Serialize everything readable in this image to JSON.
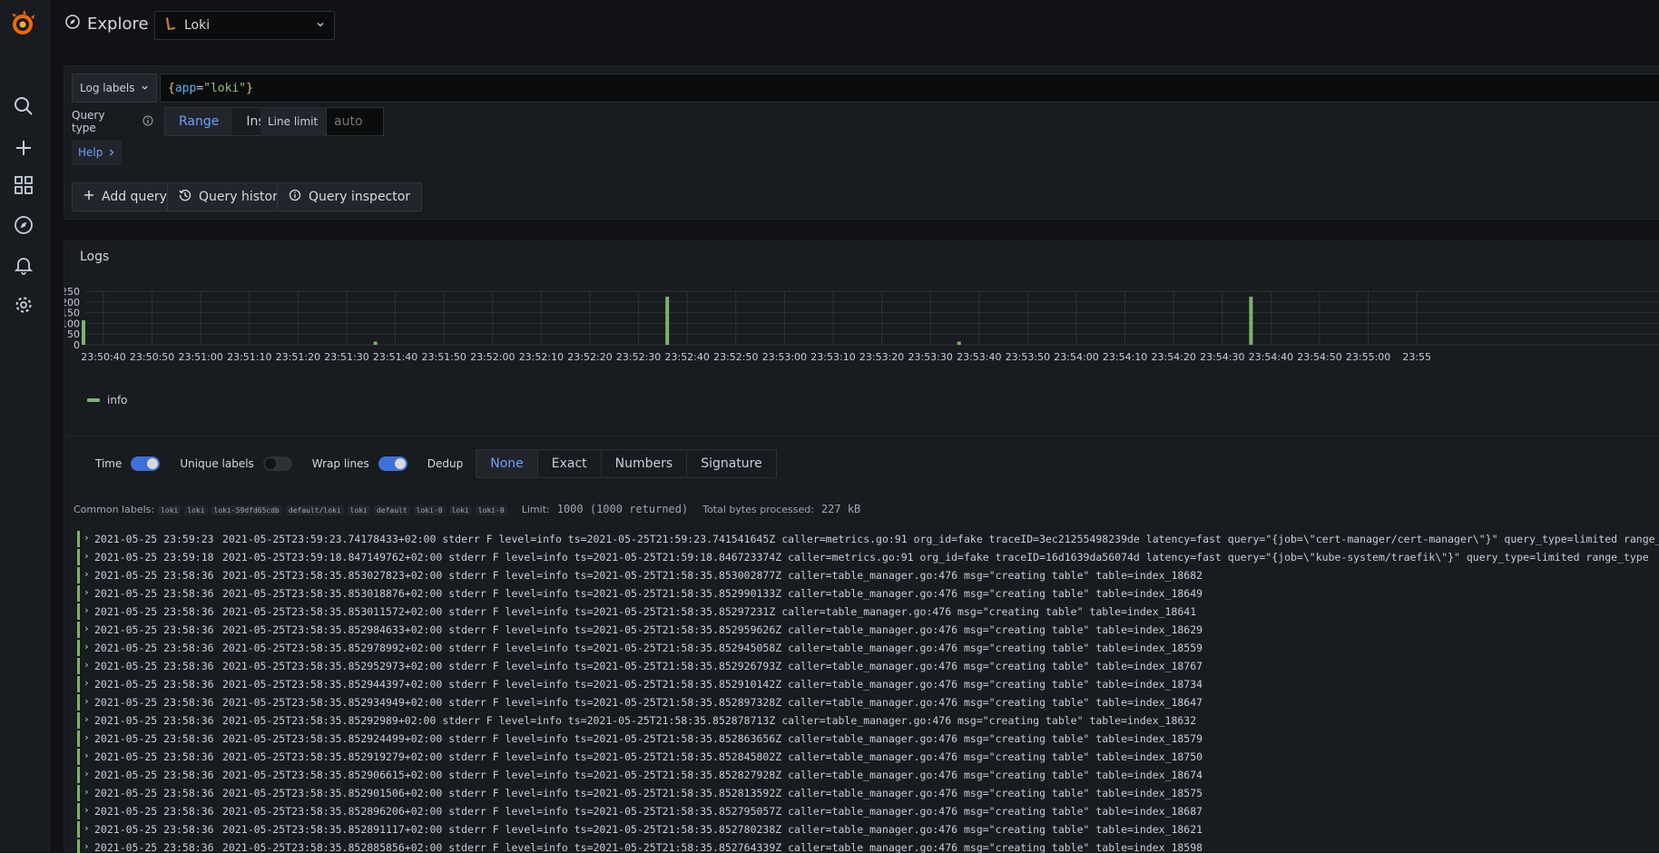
{
  "app": {
    "title": "Explore",
    "datasource": "Loki"
  },
  "sidemenu": {
    "items": [
      "search-icon",
      "plus-icon",
      "dashboards-icon",
      "explore-icon",
      "alert-bell-icon",
      "gear-icon"
    ]
  },
  "query": {
    "log_labels_button": "Log labels",
    "expression": {
      "open": "{",
      "key": "app",
      "eq": "=",
      "value": "\"loki\"",
      "close": "}"
    },
    "query_type_label": "Query type",
    "query_types": [
      "Range",
      "Instant"
    ],
    "active_query_type": "Range",
    "line_limit_label": "Line limit",
    "line_limit_placeholder": "auto",
    "help_label": "Help",
    "actions": {
      "add_query": "Add query",
      "query_history": "Query history",
      "query_inspector": "Query inspector"
    }
  },
  "logs": {
    "title": "Logs",
    "options": {
      "time_label": "Time",
      "time_on": true,
      "unique_labels_label": "Unique labels",
      "unique_labels_on": false,
      "wrap_lines_label": "Wrap lines",
      "wrap_lines_on": true,
      "dedup_label": "Dedup",
      "dedup_options": [
        "None",
        "Exact",
        "Numbers",
        "Signature"
      ],
      "dedup_active": "None"
    },
    "common_labels_label": "Common labels:",
    "common_labels": [
      "loki",
      "loki",
      "loki-59dfd65cdb",
      "default/loki",
      "loki",
      "default",
      "loki-0",
      "loki",
      "loki-0"
    ],
    "limit_label": "Limit:",
    "limit_value": "1000 (1000 returned)",
    "bytes_label": "Total bytes processed:",
    "bytes_value": "227 kB",
    "rows": [
      {
        "ts": "2021-05-25 23:59:23",
        "line": "2021-05-25T23:59:23.74178433+02:00 stderr F level=info ts=2021-05-25T21:59:23.741541645Z caller=metrics.go:91 org_id=fake traceID=3ec21255498239de latency=fast query=\"{job=\\\"cert-manager/cert-manager\\\"}\" query_type=limited range_ty"
      },
      {
        "ts": "2021-05-25 23:59:18",
        "line": "2021-05-25T23:59:18.847149762+02:00 stderr F level=info ts=2021-05-25T21:59:18.846723374Z caller=metrics.go:91 org_id=fake traceID=16d1639da56074d latency=fast query=\"{job=\\\"kube-system/traefik\\\"}\" query_type=limited range_type"
      },
      {
        "ts": "2021-05-25 23:58:36",
        "line": "2021-05-25T23:58:35.853027823+02:00 stderr F level=info ts=2021-05-25T21:58:35.853002877Z caller=table_manager.go:476 msg=\"creating table\" table=index_18682"
      },
      {
        "ts": "2021-05-25 23:58:36",
        "line": "2021-05-25T23:58:35.853018876+02:00 stderr F level=info ts=2021-05-25T21:58:35.852990133Z caller=table_manager.go:476 msg=\"creating table\" table=index_18649"
      },
      {
        "ts": "2021-05-25 23:58:36",
        "line": "2021-05-25T23:58:35.853011572+02:00 stderr F level=info ts=2021-05-25T21:58:35.85297231Z caller=table_manager.go:476 msg=\"creating table\" table=index_18641"
      },
      {
        "ts": "2021-05-25 23:58:36",
        "line": "2021-05-25T23:58:35.852984633+02:00 stderr F level=info ts=2021-05-25T21:58:35.852959626Z caller=table_manager.go:476 msg=\"creating table\" table=index_18629"
      },
      {
        "ts": "2021-05-25 23:58:36",
        "line": "2021-05-25T23:58:35.852978992+02:00 stderr F level=info ts=2021-05-25T21:58:35.852945058Z caller=table_manager.go:476 msg=\"creating table\" table=index_18559"
      },
      {
        "ts": "2021-05-25 23:58:36",
        "line": "2021-05-25T23:58:35.852952973+02:00 stderr F level=info ts=2021-05-25T21:58:35.852926793Z caller=table_manager.go:476 msg=\"creating table\" table=index_18767"
      },
      {
        "ts": "2021-05-25 23:58:36",
        "line": "2021-05-25T23:58:35.852944397+02:00 stderr F level=info ts=2021-05-25T21:58:35.852910142Z caller=table_manager.go:476 msg=\"creating table\" table=index_18734"
      },
      {
        "ts": "2021-05-25 23:58:36",
        "line": "2021-05-25T23:58:35.852934949+02:00 stderr F level=info ts=2021-05-25T21:58:35.852897328Z caller=table_manager.go:476 msg=\"creating table\" table=index_18647"
      },
      {
        "ts": "2021-05-25 23:58:36",
        "line": "2021-05-25T23:58:35.85292989+02:00 stderr F level=info ts=2021-05-25T21:58:35.852878713Z caller=table_manager.go:476 msg=\"creating table\" table=index_18632"
      },
      {
        "ts": "2021-05-25 23:58:36",
        "line": "2021-05-25T23:58:35.852924499+02:00 stderr F level=info ts=2021-05-25T21:58:35.852863656Z caller=table_manager.go:476 msg=\"creating table\" table=index_18579"
      },
      {
        "ts": "2021-05-25 23:58:36",
        "line": "2021-05-25T23:58:35.852919279+02:00 stderr F level=info ts=2021-05-25T21:58:35.852845802Z caller=table_manager.go:476 msg=\"creating table\" table=index_18750"
      },
      {
        "ts": "2021-05-25 23:58:36",
        "line": "2021-05-25T23:58:35.852906615+02:00 stderr F level=info ts=2021-05-25T21:58:35.852827928Z caller=table_manager.go:476 msg=\"creating table\" table=index_18674"
      },
      {
        "ts": "2021-05-25 23:58:36",
        "line": "2021-05-25T23:58:35.852901506+02:00 stderr F level=info ts=2021-05-25T21:58:35.852813592Z caller=table_manager.go:476 msg=\"creating table\" table=index_18575"
      },
      {
        "ts": "2021-05-25 23:58:36",
        "line": "2021-05-25T23:58:35.852896206+02:00 stderr F level=info ts=2021-05-25T21:58:35.852795057Z caller=table_manager.go:476 msg=\"creating table\" table=index_18687"
      },
      {
        "ts": "2021-05-25 23:58:36",
        "line": "2021-05-25T23:58:35.852891117+02:00 stderr F level=info ts=2021-05-25T21:58:35.852780238Z caller=table_manager.go:476 msg=\"creating table\" table=index_18621"
      },
      {
        "ts": "2021-05-25 23:58:36",
        "line": "2021-05-25T23:58:35.852885856+02:00 stderr F level=info ts=2021-05-25T21:58:35.852764339Z caller=table_manager.go:476 msg=\"creating table\" table=index_18598"
      }
    ]
  },
  "chart_data": {
    "type": "bar",
    "title": "",
    "xlabel": "",
    "ylabel": "",
    "ylim": [
      0,
      250
    ],
    "y_ticks": [
      0,
      50,
      100,
      150,
      200,
      250
    ],
    "x_tick_labels": [
      "23:50:40",
      "23:50:50",
      "23:51:00",
      "23:51:10",
      "23:51:20",
      "23:51:30",
      "23:51:40",
      "23:51:50",
      "23:52:00",
      "23:52:10",
      "23:52:20",
      "23:52:30",
      "23:52:40",
      "23:52:50",
      "23:53:00",
      "23:53:10",
      "23:53:20",
      "23:53:30",
      "23:53:40",
      "23:53:50",
      "23:54:00",
      "23:54:10",
      "23:54:20",
      "23:54:30",
      "23:54:40",
      "23:54:50",
      "23:55:00",
      "23:55"
    ],
    "series": [
      {
        "name": "info",
        "color": "#7eb26d",
        "points": [
          {
            "x": "23:50:40",
            "y": 115
          },
          {
            "x": "23:51:40",
            "y": 15
          },
          {
            "x": "23:52:40",
            "y": 225
          },
          {
            "x": "23:53:40",
            "y": 15
          },
          {
            "x": "23:54:40",
            "y": 225
          }
        ]
      }
    ],
    "grid": true,
    "legend": "bottom-left"
  }
}
